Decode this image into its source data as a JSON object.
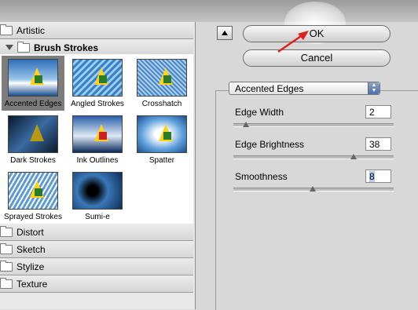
{
  "categories_top": [
    {
      "label": "Artistic",
      "expanded": false
    },
    {
      "label": "Brush Strokes",
      "expanded": true
    }
  ],
  "thumbnails": [
    {
      "label": "Accented Edges",
      "selected": true
    },
    {
      "label": "Angled Strokes",
      "selected": false
    },
    {
      "label": "Crosshatch",
      "selected": false
    },
    {
      "label": "Dark Strokes",
      "selected": false
    },
    {
      "label": "Ink Outlines",
      "selected": false
    },
    {
      "label": "Spatter",
      "selected": false
    },
    {
      "label": "Sprayed Strokes",
      "selected": false
    },
    {
      "label": "Sumi-e",
      "selected": false
    }
  ],
  "categories_bottom": [
    {
      "label": "Distort"
    },
    {
      "label": "Sketch"
    },
    {
      "label": "Stylize"
    },
    {
      "label": "Texture"
    }
  ],
  "buttons": {
    "ok": "OK",
    "cancel": "Cancel"
  },
  "filter_select": {
    "value": "Accented Edges"
  },
  "params": [
    {
      "label": "Edge Width",
      "value": "2"
    },
    {
      "label": "Edge Brightness",
      "value": "38"
    },
    {
      "label": "Smoothness",
      "value": "8"
    }
  ],
  "colors": {
    "accent_arrow": "#e02020",
    "selection": "#7d7d7d",
    "highlight": "#b4cdf2"
  }
}
